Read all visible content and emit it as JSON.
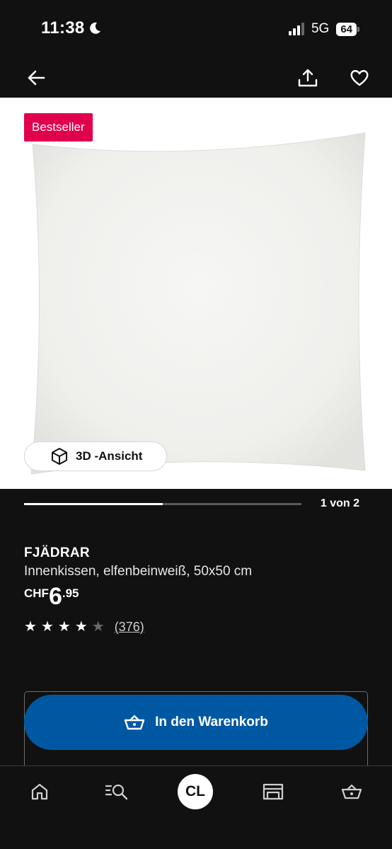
{
  "status_bar": {
    "time": "11:38",
    "network": "5G",
    "battery": "64"
  },
  "nav": {
    "back_icon": "arrow-left-icon",
    "share_icon": "share-icon",
    "favorite_icon": "heart-icon"
  },
  "gallery": {
    "badge": "Bestseller",
    "view_3d_label": "3D -Ansicht",
    "page_indicator": "1 von 2",
    "progress_fraction": 0.5
  },
  "product": {
    "name": "FJÄDRAR",
    "description": "Innenkissen, elfenbeinweiß, 50x50 cm",
    "price_currency": "CHF",
    "price_integer": "6",
    "price_decimal": ".95",
    "rating": 4,
    "rating_max": 5,
    "review_count": "(376)"
  },
  "cta": {
    "label": "In den Warenkorb"
  },
  "tab_bar": {
    "items": [
      "home-icon",
      "search-icon",
      "avatar",
      "store-icon",
      "cart-icon"
    ],
    "avatar_initials": "CL"
  },
  "colors": {
    "background": "#111111",
    "badge": "#e0004d",
    "cta": "#0058a3"
  }
}
